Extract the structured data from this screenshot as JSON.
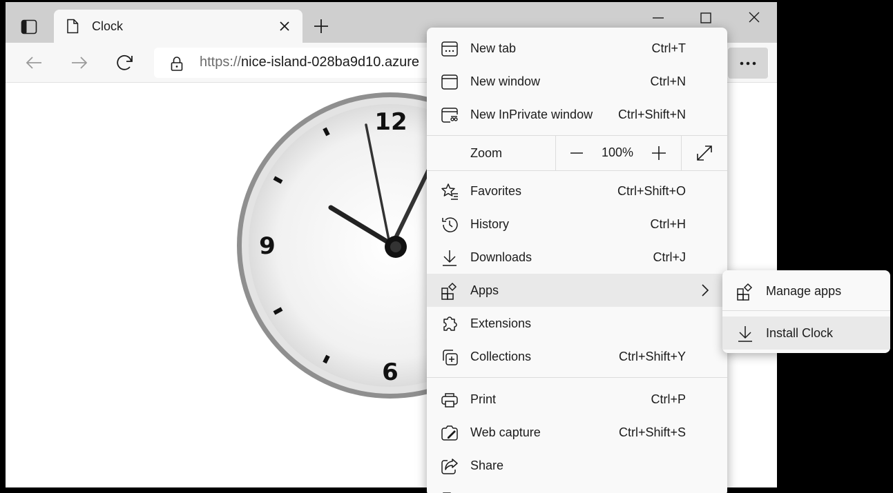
{
  "tab": {
    "title": "Clock"
  },
  "address": {
    "protocol": "https://",
    "host": "nice-island-028ba9d10.azure"
  },
  "clock": {
    "numbers": {
      "twelve": "12",
      "nine": "9",
      "six": "6"
    }
  },
  "menu": {
    "items_top": [
      {
        "label": "New tab",
        "shortcut": "Ctrl+T"
      },
      {
        "label": "New window",
        "shortcut": "Ctrl+N"
      },
      {
        "label": "New InPrivate window",
        "shortcut": "Ctrl+Shift+N"
      }
    ],
    "zoom": {
      "label": "Zoom",
      "value": "100%"
    },
    "items_mid": [
      {
        "label": "Favorites",
        "shortcut": "Ctrl+Shift+O"
      },
      {
        "label": "History",
        "shortcut": "Ctrl+H"
      },
      {
        "label": "Downloads",
        "shortcut": "Ctrl+J"
      },
      {
        "label": "Apps",
        "shortcut": ""
      },
      {
        "label": "Extensions",
        "shortcut": ""
      },
      {
        "label": "Collections",
        "shortcut": "Ctrl+Shift+Y"
      }
    ],
    "items_bottom": [
      {
        "label": "Print",
        "shortcut": "Ctrl+P"
      },
      {
        "label": "Web capture",
        "shortcut": "Ctrl+Shift+S"
      },
      {
        "label": "Share",
        "shortcut": ""
      }
    ]
  },
  "apps_submenu": {
    "items": [
      {
        "label": "Manage apps"
      },
      {
        "label": "Install Clock"
      }
    ]
  },
  "icons": {
    "tab_actions": "tab-actions-icon",
    "page": "page-icon",
    "close": "close-icon",
    "plus": "plus-icon",
    "back": "back-arrow-icon",
    "forward": "forward-arrow-icon",
    "refresh": "refresh-icon",
    "lock": "lock-icon",
    "more": "more-dots-icon"
  },
  "colors": {
    "menu_bg": "#f9f9f9",
    "hover": "#e9e9e9",
    "tabstrip": "#cfcfcf"
  }
}
